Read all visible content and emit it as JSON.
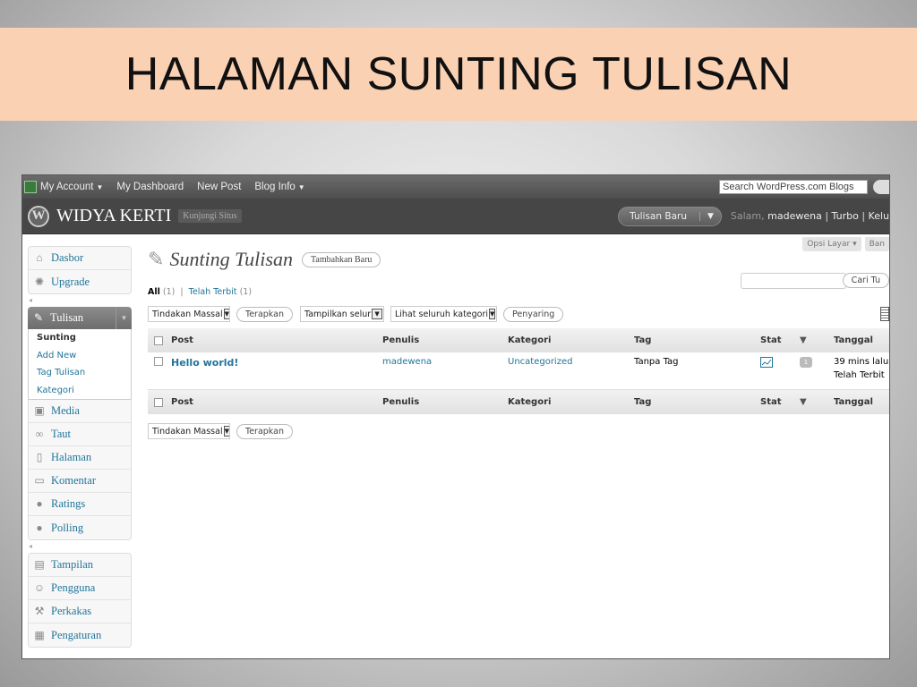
{
  "slide": {
    "title": "HALAMAN SUNTING TULISAN"
  },
  "adminbar": {
    "items": [
      "My Account",
      "My Dashboard",
      "New Post",
      "Blog Info"
    ],
    "search_placeholder": "Search WordPress.com Blogs"
  },
  "header": {
    "site_name": "WIDYA KERTI",
    "visit_site": "Kunjungi Situs",
    "favorite_action": "Tulisan Baru",
    "greeting_prefix": "Salam,",
    "user": "madewena",
    "turbo": "Turbo",
    "logout": "Kelu"
  },
  "sidebar": {
    "top": [
      {
        "label": "Dasbor",
        "icon": "home-icon"
      },
      {
        "label": "Upgrade",
        "icon": "upgrade-icon"
      }
    ],
    "active": {
      "label": "Tulisan",
      "icon": "pin-icon"
    },
    "submenu": [
      "Sunting",
      "Add New",
      "Tag Tulisan",
      "Kategori"
    ],
    "middle": [
      {
        "label": "Media",
        "icon": "media-icon"
      },
      {
        "label": "Taut",
        "icon": "link-icon"
      },
      {
        "label": "Halaman",
        "icon": "page-icon"
      },
      {
        "label": "Komentar",
        "icon": "comment-icon"
      },
      {
        "label": "Ratings",
        "icon": "ratings-icon"
      },
      {
        "label": "Polling",
        "icon": "polling-icon"
      }
    ],
    "bottom": [
      {
        "label": "Tampilan",
        "icon": "appearance-icon"
      },
      {
        "label": "Pengguna",
        "icon": "users-icon"
      },
      {
        "label": "Perkakas",
        "icon": "tools-icon"
      },
      {
        "label": "Pengaturan",
        "icon": "settings-icon"
      }
    ]
  },
  "main": {
    "screen_options": "Opsi Layar",
    "help": "Ban",
    "page_title": "Sunting Tulisan",
    "add_new": "Tambahkan Baru",
    "filter_all": "All",
    "filter_all_count": "(1)",
    "filter_published": "Telah Terbit",
    "filter_published_count": "(1)",
    "search_button": "Cari Tu",
    "bulk_actions": "Tindakan Massal",
    "apply": "Terapkan",
    "show_all_dates": "Tampilkan selur",
    "view_all_categories": "Lihat seluruh kategori",
    "filter_button": "Penyaring",
    "columns": [
      "Post",
      "Penulis",
      "Kategori",
      "Tag",
      "Stat",
      "Tanggal"
    ],
    "rows": [
      {
        "title": "Hello world!",
        "author": "madewena",
        "category": "Uncategorized",
        "tags": "Tanpa Tag",
        "comments": "1",
        "date": "39 mins lalu",
        "status": "Telah Terbit"
      }
    ]
  }
}
